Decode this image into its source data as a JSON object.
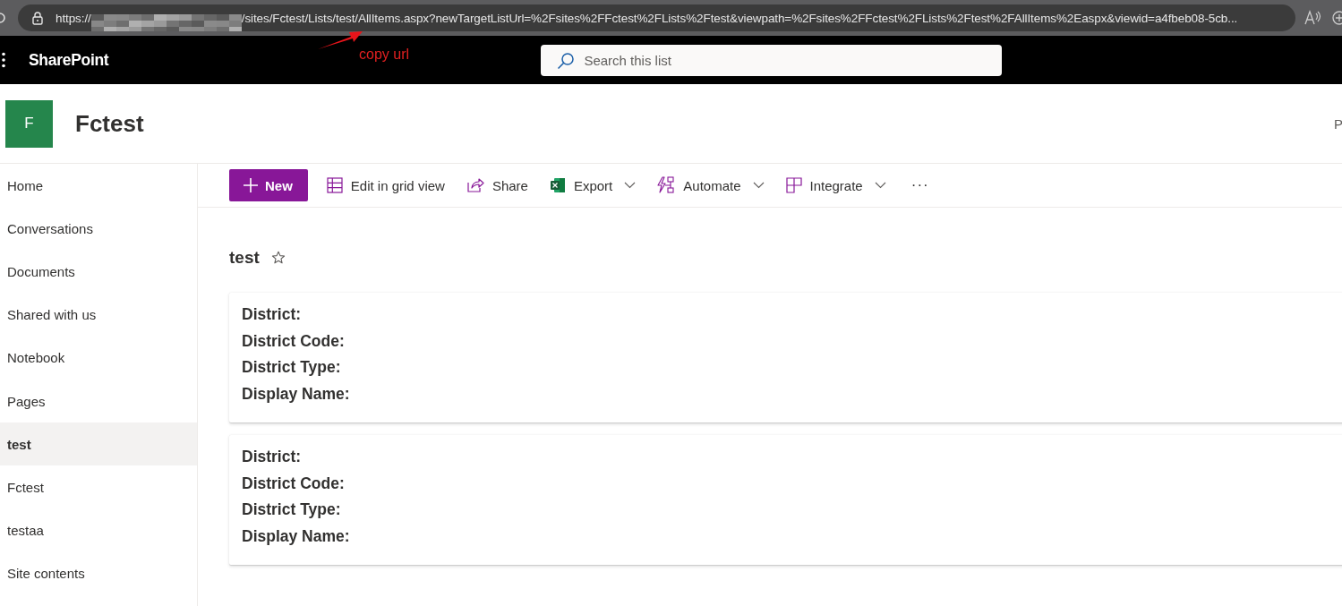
{
  "browser": {
    "url_start": "https://",
    "url_end": "/sites/Fctest/Lists/test/AllItems.aspx?newTargetListUrl=%2Fsites%2FFctest%2FLists%2Ftest&viewpath=%2Fsites%2FFctest%2FLists%2Ftest%2FAllItems%2Easpx&viewid=a4fbeb08-5cb..."
  },
  "annotation": {
    "text": "copy url"
  },
  "suite_bar": {
    "app_name": "SharePoint",
    "search": {
      "placeholder": "Search this list"
    }
  },
  "site": {
    "logo_letter": "F",
    "title": "Fctest",
    "header_right": "P"
  },
  "nav": {
    "items": [
      {
        "label": "Home",
        "selected": false
      },
      {
        "label": "Conversations",
        "selected": false
      },
      {
        "label": "Documents",
        "selected": false
      },
      {
        "label": "Shared with us",
        "selected": false
      },
      {
        "label": "Notebook",
        "selected": false
      },
      {
        "label": "Pages",
        "selected": false
      },
      {
        "label": "test",
        "selected": true
      },
      {
        "label": "Fctest",
        "selected": false
      },
      {
        "label": "testaa",
        "selected": false
      },
      {
        "label": "Site contents",
        "selected": false
      }
    ]
  },
  "command_bar": {
    "items": [
      {
        "kind": "primary",
        "label": "New"
      },
      {
        "kind": "action",
        "label": "Edit in grid view",
        "dropdown": false
      },
      {
        "kind": "action",
        "label": "Share",
        "dropdown": false
      },
      {
        "kind": "action",
        "label": "Export",
        "dropdown": true
      },
      {
        "kind": "action",
        "label": "Automate",
        "dropdown": true
      },
      {
        "kind": "action",
        "label": "Integrate",
        "dropdown": true
      },
      {
        "kind": "more",
        "label": "···"
      }
    ]
  },
  "list": {
    "title": "test",
    "favorite": false,
    "cards": [
      {
        "fields": [
          "District:",
          "District Code:",
          "District Type:",
          "Display Name:"
        ]
      },
      {
        "fields": [
          "District:",
          "District Code:",
          "District Type:",
          "Display Name:"
        ]
      }
    ]
  }
}
